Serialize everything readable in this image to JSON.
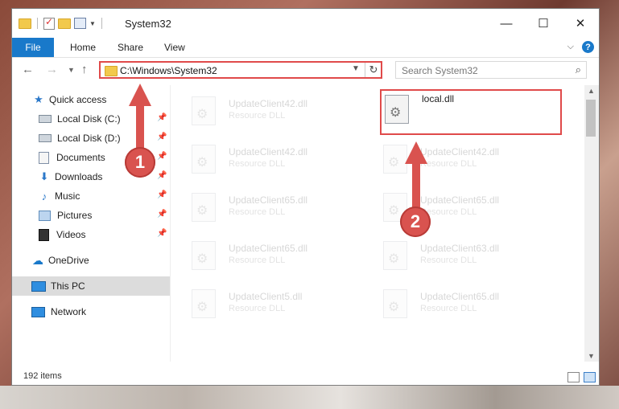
{
  "window": {
    "title": "System32",
    "minimize": "—",
    "maximize": "☐",
    "close": "✕"
  },
  "ribbon": {
    "tabs": [
      "File",
      "Home",
      "Share",
      "View"
    ],
    "collapse_icon": "chevron-down-icon",
    "help_label": "?"
  },
  "address": {
    "path": "C:\\Windows\\System32",
    "search_placeholder": "Search System32"
  },
  "nav": {
    "items": [
      {
        "label": "Quick access",
        "icon": "star-icon",
        "pinned": false
      },
      {
        "label": "Local Disk (C:)",
        "icon": "disk-icon",
        "pinned": true
      },
      {
        "label": "Local Disk (D:)",
        "icon": "disk-icon",
        "pinned": true
      },
      {
        "label": "Documents",
        "icon": "documents-icon",
        "pinned": true
      },
      {
        "label": "Downloads",
        "icon": "download-icon",
        "pinned": true
      },
      {
        "label": "Music",
        "icon": "music-icon",
        "pinned": true
      },
      {
        "label": "Pictures",
        "icon": "pictures-icon",
        "pinned": true
      },
      {
        "label": "Videos",
        "icon": "videos-icon",
        "pinned": true
      },
      {
        "label": "OneDrive",
        "icon": "cloud-icon",
        "pinned": false
      },
      {
        "label": "This PC",
        "icon": "computer-icon",
        "pinned": false,
        "selected": true
      },
      {
        "label": "Network",
        "icon": "network-icon",
        "pinned": false
      }
    ]
  },
  "files": [
    {
      "name": "UpdateClient42.dll",
      "type": "Resource DLL",
      "faded": true
    },
    {
      "name": "local.dll",
      "type": "",
      "faded": false,
      "highlighted": true
    },
    {
      "name": "UpdateClient42.dll",
      "type": "Resource DLL",
      "faded": true
    },
    {
      "name": "UpdateClient42.dll",
      "type": "Resource DLL",
      "faded": true
    },
    {
      "name": "UpdateClient65.dll",
      "type": "Resource DLL",
      "faded": true
    },
    {
      "name": "UpdateClient65.dll",
      "type": "Resource DLL",
      "faded": true
    },
    {
      "name": "UpdateClient65.dll",
      "type": "Resource DLL",
      "faded": true
    },
    {
      "name": "UpdateClient63.dll",
      "type": "Resource DLL",
      "faded": true
    },
    {
      "name": "UpdateClient5.dll",
      "type": "Resource DLL",
      "faded": true
    },
    {
      "name": "UpdateClient65.dll",
      "type": "Resource DLL",
      "faded": true
    }
  ],
  "status": {
    "item_count": "192 items"
  },
  "annotations": {
    "badge_1": "1",
    "badge_2": "2",
    "color": "#d9534f"
  }
}
